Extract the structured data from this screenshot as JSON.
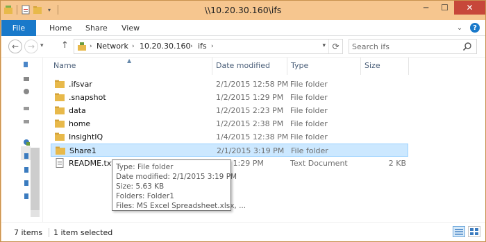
{
  "window": {
    "title": "\\\\10.20.30.160\\ifs"
  },
  "ribbon": {
    "tabs": {
      "file": "File",
      "home": "Home",
      "share": "Share",
      "view": "View"
    }
  },
  "address": {
    "crumbs": [
      "Network",
      "10.20.30.160",
      "ifs"
    ]
  },
  "search": {
    "placeholder": "Search ifs"
  },
  "columns": {
    "name": "Name",
    "date": "Date modified",
    "type": "Type",
    "size": "Size"
  },
  "files": [
    {
      "name": ".ifsvar",
      "date": "2/1/2015 12:58 PM",
      "type": "File folder",
      "size": "",
      "icon": "folder-icon"
    },
    {
      "name": ".snapshot",
      "date": "1/2/2015 1:29 PM",
      "type": "File folder",
      "size": "",
      "icon": "folder-icon"
    },
    {
      "name": "data",
      "date": "1/2/2015 2:23 PM",
      "type": "File folder",
      "size": "",
      "icon": "folder-icon"
    },
    {
      "name": "home",
      "date": "1/2/2015 2:38 PM",
      "type": "File folder",
      "size": "",
      "icon": "folder-icon"
    },
    {
      "name": "InsightIQ",
      "date": "1/4/2015 12:38 PM",
      "type": "File folder",
      "size": "",
      "icon": "folder-icon"
    },
    {
      "name": "Share1",
      "date": "2/1/2015 3:19 PM",
      "type": "File folder",
      "size": "",
      "icon": "folder-icon",
      "selected": true
    },
    {
      "name": "README.txt",
      "date": "015 1:29 PM",
      "type": "Text Document",
      "size": "2 KB",
      "icon": "text-file-icon"
    }
  ],
  "tooltip": {
    "lines": [
      "Type: File folder",
      "Date modified: 2/1/2015 3:19 PM",
      "Size: 5.63 KB",
      "Folders: Folder1",
      "Files: MS Excel Spreadsheet.xlsx, ..."
    ]
  },
  "status": {
    "items": "7 items",
    "selected": "1 item selected"
  },
  "colors": {
    "titlebar": "#f6c68f",
    "accent": "#1979ca",
    "selection": "#cce8ff",
    "selection_border": "#99d1ff",
    "folder": "#e8b94a",
    "close": "#c7473a"
  }
}
